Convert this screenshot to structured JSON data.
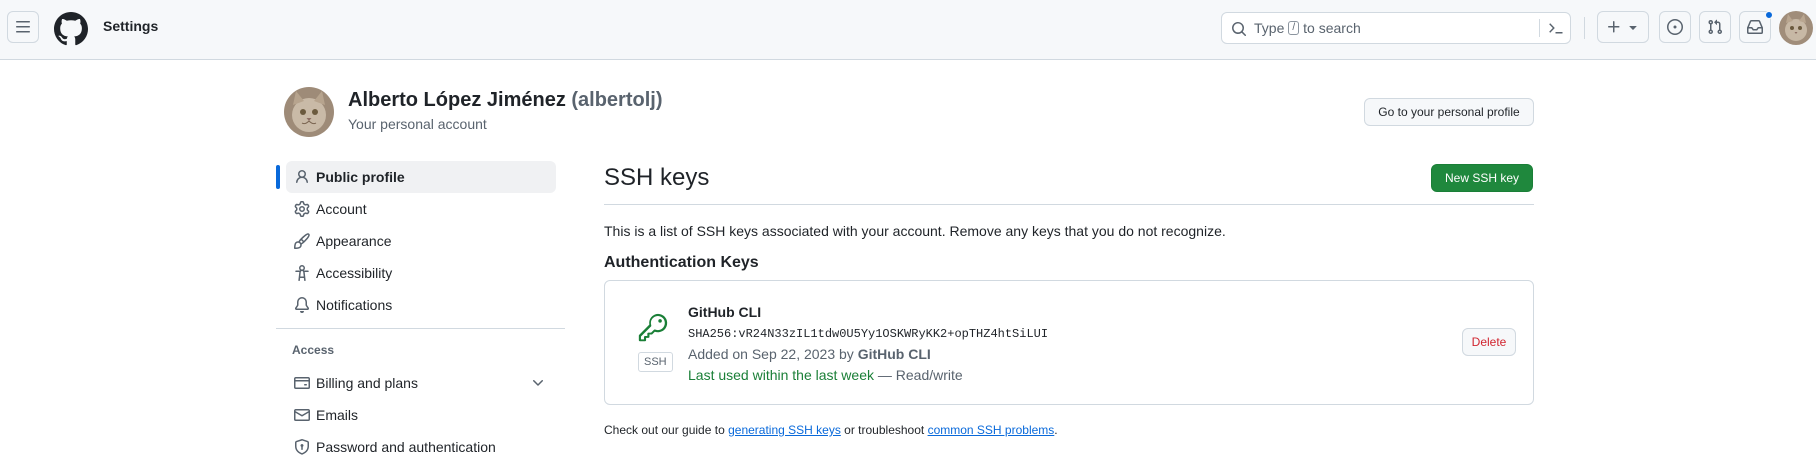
{
  "header": {
    "title": "Settings",
    "search_placeholder_before": "Type",
    "search_shortcut": "/",
    "search_placeholder_after": "to search"
  },
  "profile": {
    "name": "Alberto López Jiménez",
    "login": "(albertolj)",
    "subtitle": "Your personal account",
    "profile_button": "Go to your personal profile"
  },
  "sidebar": {
    "items": [
      {
        "label": "Public profile",
        "icon": "person-icon",
        "active": true
      },
      {
        "label": "Account",
        "icon": "gear-icon"
      },
      {
        "label": "Appearance",
        "icon": "paintbrush-icon"
      },
      {
        "label": "Accessibility",
        "icon": "accessibility-icon"
      },
      {
        "label": "Notifications",
        "icon": "bell-icon"
      }
    ],
    "access_heading": "Access",
    "access_items": [
      {
        "label": "Billing and plans",
        "icon": "credit-card-icon"
      },
      {
        "label": "Emails",
        "icon": "mail-icon"
      },
      {
        "label": "Password and authentication",
        "icon": "shield-lock-icon"
      }
    ]
  },
  "main": {
    "title": "SSH keys",
    "new_button": "New SSH key",
    "intro": "This is a list of SSH keys associated with your account. Remove any keys that you do not recognize.",
    "subheading": "Authentication Keys",
    "key": {
      "badge": "SSH",
      "name": "GitHub CLI",
      "fingerprint": "SHA256:vR24N33zIL1tdw0U5Yy1OSKWRyKK2+opTHZ4htSiLUI",
      "added_prefix": "Added on Sep 22, 2023 by",
      "added_by": "GitHub CLI",
      "last_used": "Last used within the last week",
      "access": "— Read/write",
      "delete_label": "Delete"
    },
    "footer": {
      "prefix": "Check out our guide to",
      "link1": "generating SSH keys",
      "middle": "or troubleshoot",
      "link2": "common SSH problems",
      "suffix": "."
    }
  },
  "colors": {
    "accent": "#0969da",
    "primary_button": "#1f883d",
    "danger": "#d1242f",
    "success_text": "#1a7f37"
  }
}
